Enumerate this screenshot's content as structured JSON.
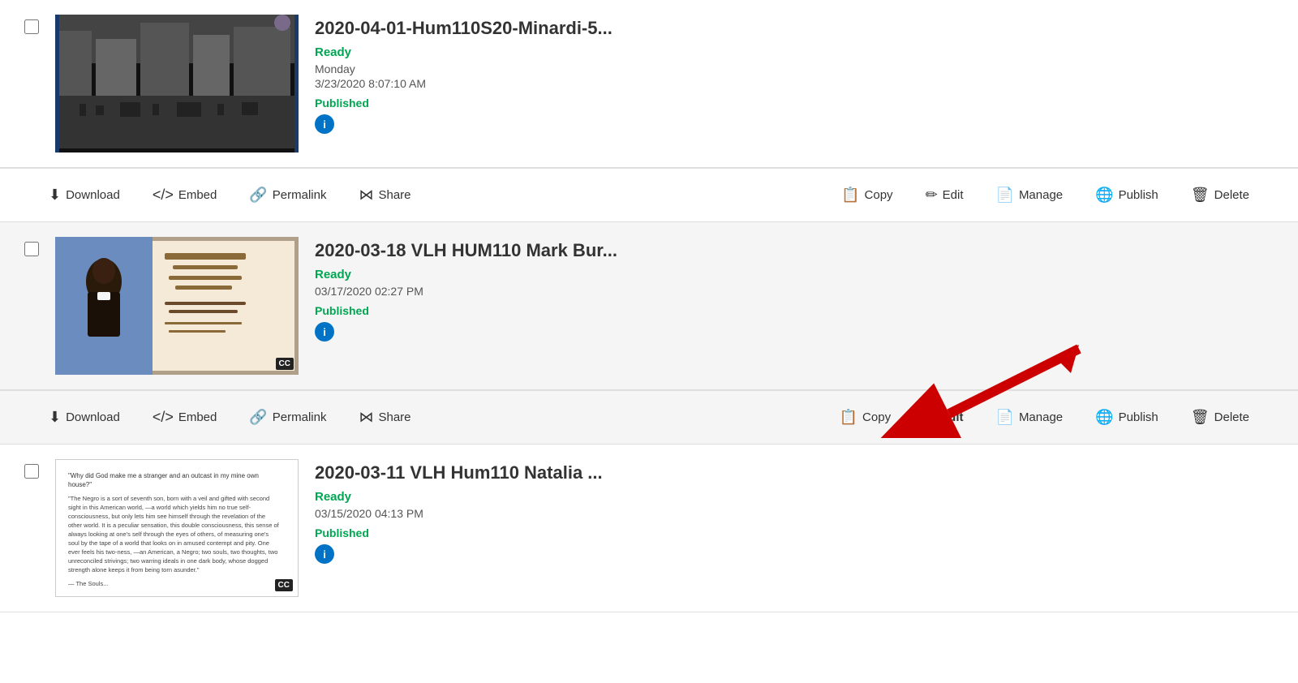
{
  "items": [
    {
      "id": "item1",
      "title": "2020-04-01-Hum110S20-Minardi-5...",
      "status": "Ready",
      "day": "Monday",
      "date": "3/23/2020 8:07:10 AM",
      "published_label": "Published",
      "alt_bg": false,
      "has_cc": false,
      "thumbnail_type": "bw"
    },
    {
      "id": "item2",
      "title": "2020-03-18 VLH HUM110 Mark Bur...",
      "status": "Ready",
      "day": "",
      "date": "03/17/2020 02:27 PM",
      "published_label": "Published",
      "alt_bg": true,
      "has_cc": true,
      "thumbnail_type": "book",
      "has_arrow": true
    },
    {
      "id": "item3",
      "title": "2020-03-11 VLH Hum110 Natalia ...",
      "status": "Ready",
      "day": "",
      "date": "03/15/2020 04:13 PM",
      "published_label": "Published",
      "alt_bg": false,
      "has_cc": true,
      "thumbnail_type": "text"
    }
  ],
  "actions": {
    "download": "Download",
    "embed": "Embed",
    "permalink": "Permalink",
    "share": "Share",
    "copy": "Copy",
    "edit": "Edit",
    "manage": "Manage",
    "publish": "Publish",
    "delete": "Delete"
  },
  "icons": {
    "download": "⬇",
    "embed": "</>",
    "permalink": "🔗",
    "share": "⋈",
    "copy": "📋",
    "edit": "✏",
    "manage": "📄",
    "publish": "🌐",
    "delete": "🗑",
    "info": "i"
  }
}
